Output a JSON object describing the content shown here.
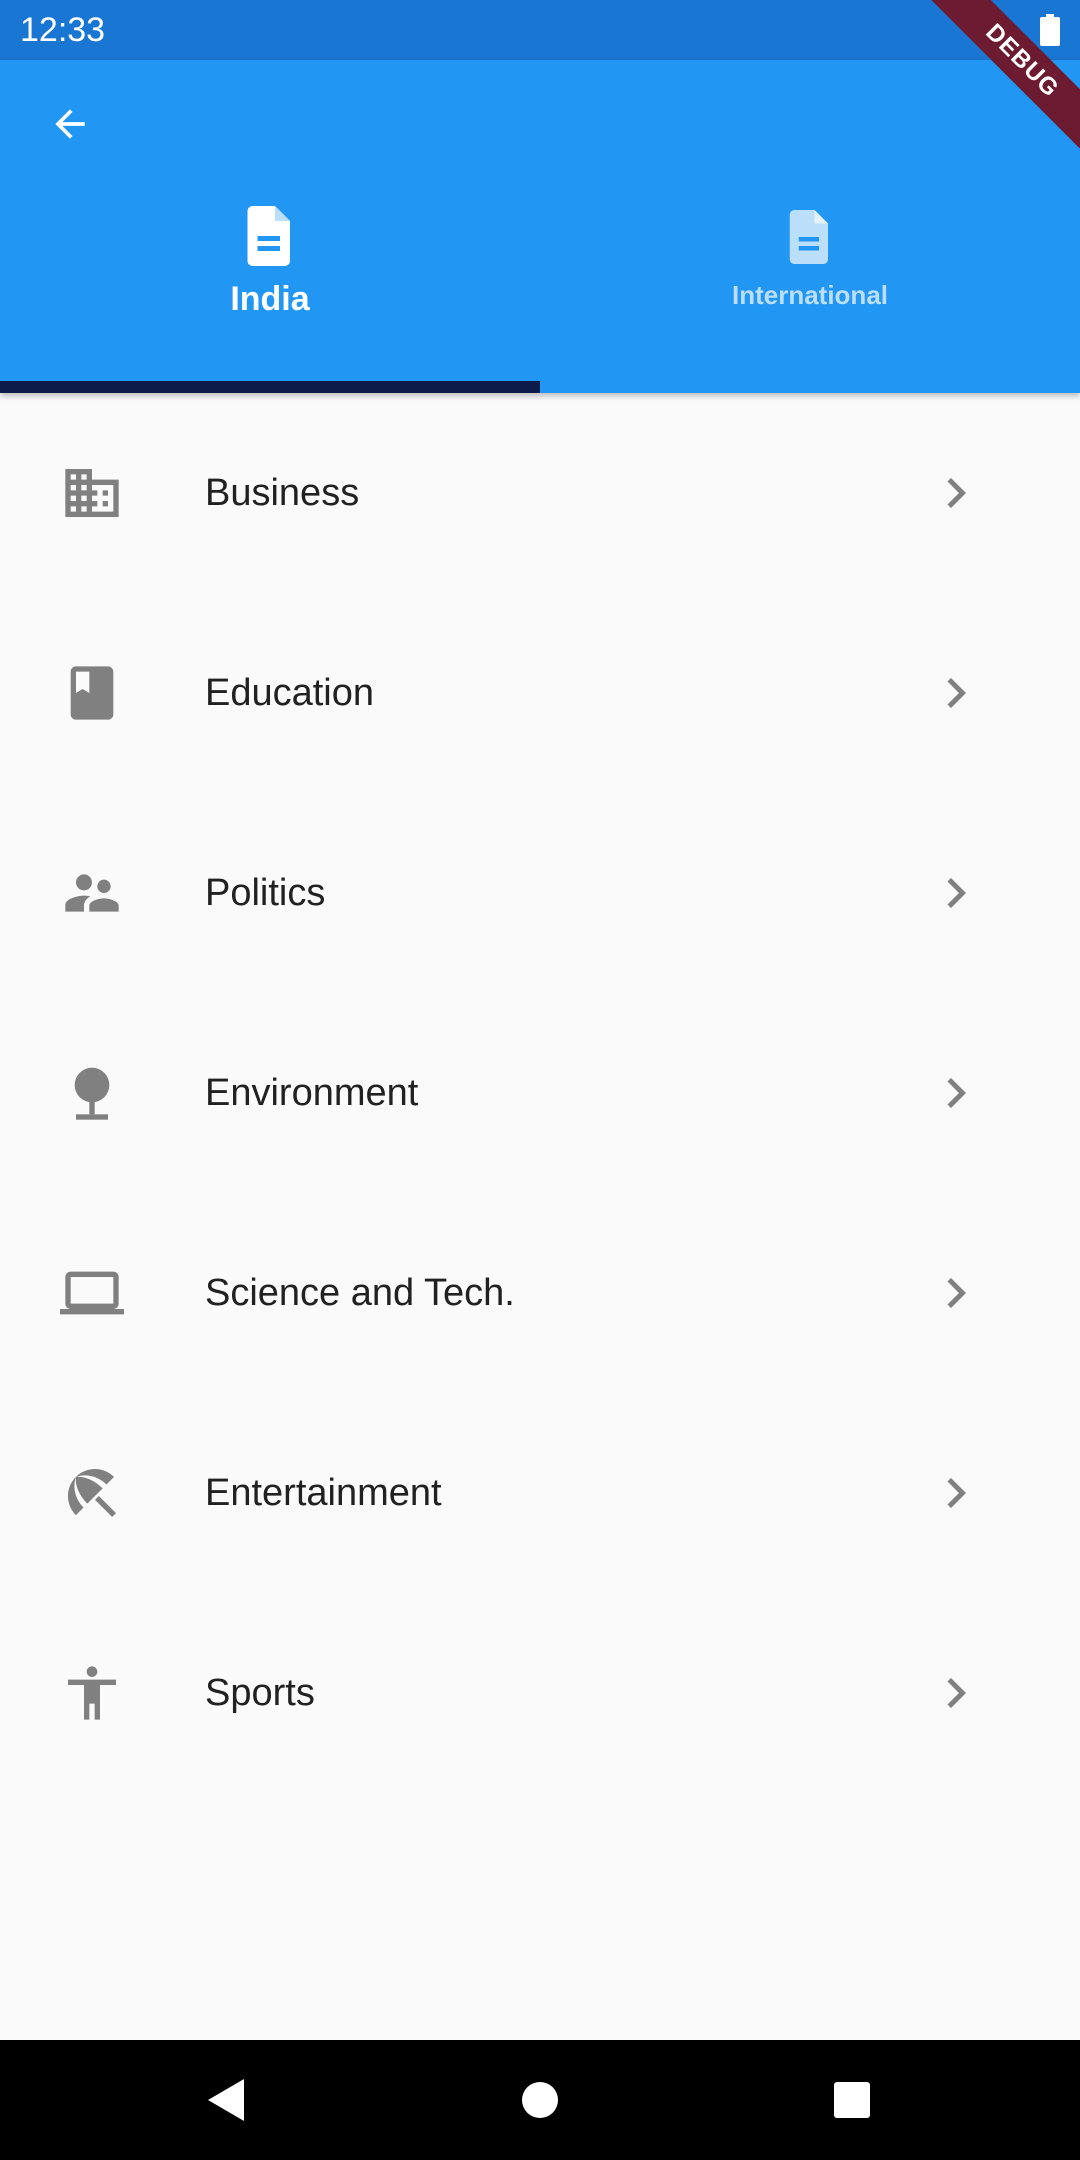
{
  "status_bar": {
    "time": "12:33"
  },
  "debug_banner": {
    "label": "DEBUG"
  },
  "app_bar": {
    "back_icon": "arrow-back-icon",
    "tabs": [
      {
        "label": "India",
        "icon": "document-icon",
        "selected": true
      },
      {
        "label": "International",
        "icon": "document-icon",
        "selected": false
      }
    ]
  },
  "categories": [
    {
      "label": "Business",
      "icon": "business-building-icon"
    },
    {
      "label": "Education",
      "icon": "book-icon"
    },
    {
      "label": "Politics",
      "icon": "people-icon"
    },
    {
      "label": "Environment",
      "icon": "tree-icon"
    },
    {
      "label": "Science and Tech.",
      "icon": "laptop-icon"
    },
    {
      "label": "Entertainment",
      "icon": "umbrella-beach-icon"
    },
    {
      "label": "Sports",
      "icon": "accessibility-person-icon"
    }
  ],
  "colors": {
    "app_bar": "#2196f3",
    "status_bar": "#1976d2",
    "tab_indicator": "#0d1b4a",
    "icon_gray": "#808080",
    "text": "#212121",
    "background": "#fafafa"
  }
}
